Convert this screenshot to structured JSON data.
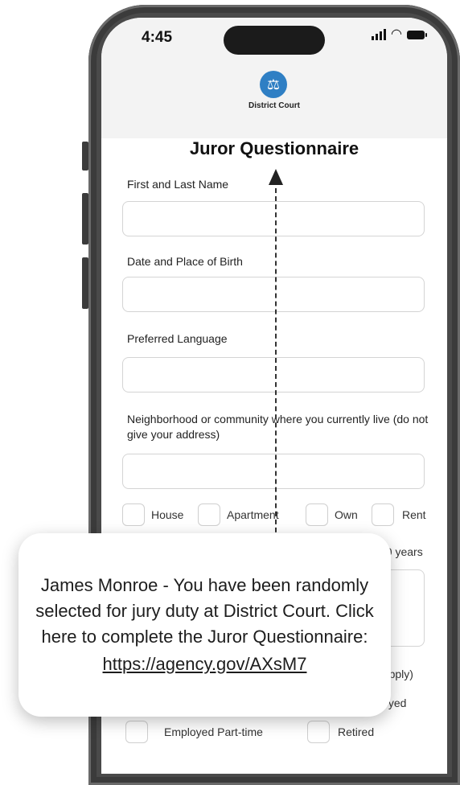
{
  "status_bar": {
    "time": "4:45"
  },
  "header": {
    "org_name": "District Court",
    "logo_icon": "scales-of-justice-icon"
  },
  "form": {
    "title": "Juror Questionnaire",
    "fields": [
      {
        "label": "First and Last Name",
        "value": ""
      },
      {
        "label": "Date and Place of Birth",
        "value": ""
      },
      {
        "label": "Preferred Language",
        "value": ""
      },
      {
        "label": "Neighborhood or community where you currently live (do not give your address)",
        "value": ""
      }
    ],
    "housing_options": [
      "House",
      "Apartment",
      "Own",
      "Rent"
    ],
    "partial_text": {
      "years": "10 years",
      "apply": "t apply)",
      "employed": "loyed"
    },
    "employment_options": [
      "Employed Part-time",
      "Retired"
    ]
  },
  "notification": {
    "message": "James Monroe - You have been randomly selected for jury duty at District Court. Click here to complete the Juror Questionnaire:",
    "link": "https://agency.gov/AXsM7"
  },
  "colors": {
    "logo": "#2f7fc4",
    "phone_frame": "#4a4a4a"
  }
}
